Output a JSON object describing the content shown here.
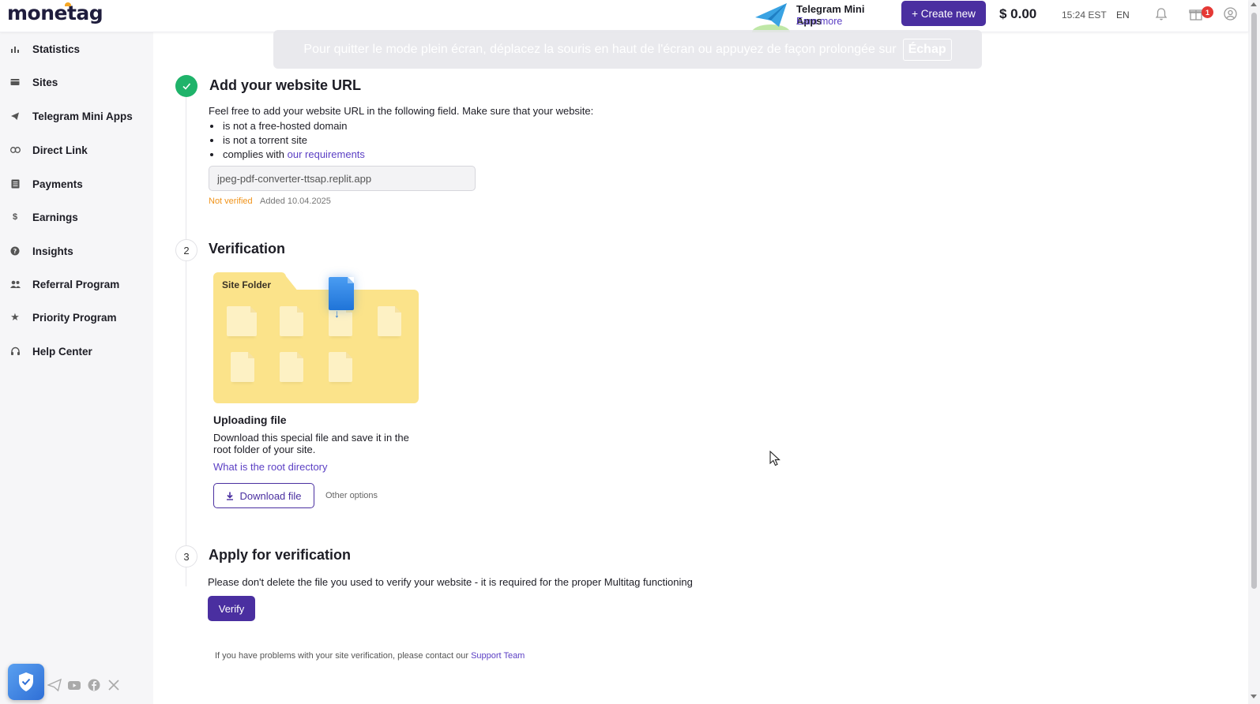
{
  "topbar": {
    "logo": "monetag",
    "promo_title": "Telegram Mini Apps",
    "promo_link": "Earn more",
    "create_button": "+ Create new",
    "balance": "$ 0.00",
    "time": "15:24 EST",
    "language": "EN",
    "gift_badge": "1"
  },
  "fullscreen_notice": {
    "text": "Pour quitter le mode plein écran, déplacez la souris en haut de l'écran ou appuyez de façon prolongée sur",
    "key": "Échap"
  },
  "sidebar": {
    "items": [
      {
        "label": "Statistics",
        "icon": "bar-chart-icon"
      },
      {
        "label": "Sites",
        "icon": "sites-icon"
      },
      {
        "label": "Telegram Mini Apps",
        "icon": "telegram-icon"
      },
      {
        "label": "Direct Link",
        "icon": "link-icon"
      },
      {
        "label": "Payments",
        "icon": "payments-icon"
      },
      {
        "label": "Earnings",
        "icon": "dollar-icon"
      },
      {
        "label": "Insights",
        "icon": "insights-icon"
      },
      {
        "label": "Referral Program",
        "icon": "referral-icon"
      },
      {
        "label": "Priority Program",
        "icon": "star-icon"
      },
      {
        "label": "Help Center",
        "icon": "headset-icon"
      }
    ]
  },
  "step1": {
    "title": "Add your website URL",
    "intro": "Feel free to add your website URL in the following field. Make sure that your website:",
    "requirements": [
      "is not a free-hosted domain",
      "is not a torrent site",
      "complies with "
    ],
    "requirements_link": "our requirements",
    "url_value": "jpeg-pdf-converter-ttsap.replit.app",
    "status": "Not verified",
    "added": "Added 10.04.2025"
  },
  "step2": {
    "number": "2",
    "title": "Verification",
    "folder_label": "Site Folder",
    "upload_title": "Uploading file",
    "upload_desc": "Download this special file and save it in the root folder of your site.",
    "root_link": "What is the root directory",
    "download_button": "Download file",
    "other_options": "Other options"
  },
  "step3": {
    "number": "3",
    "title": "Apply for verification",
    "description": "Please don't delete the file you used to verify your website - it is required for the proper Multitag functioning",
    "verify_button": "Verify"
  },
  "support": {
    "text": "If you have problems with your site verification, please contact our ",
    "link": "Support Team"
  },
  "colors": {
    "accent": "#4a2fa0",
    "success": "#1fb36a",
    "warning": "#f0931a",
    "folder": "#fbe38a"
  }
}
